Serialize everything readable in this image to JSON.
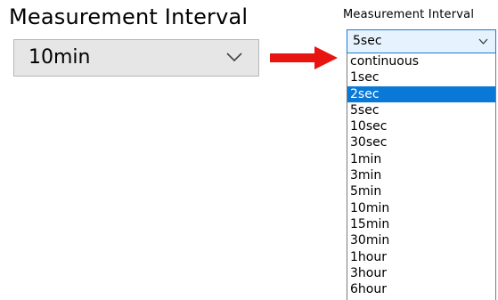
{
  "collapsed_dropdown": {
    "label": "Measurement Interval",
    "value": "10min",
    "icon": "chevron-down-icon"
  },
  "arrow": {
    "icon": "arrow-right-icon",
    "color": "#e8140f"
  },
  "expanded_dropdown": {
    "label": "Measurement Interval",
    "value": "5sec",
    "icon": "chevron-down-icon",
    "highlight_color": "#0a78d7",
    "selected_index": 2,
    "options": [
      "continuous",
      "1sec",
      "2sec",
      "5sec",
      "10sec",
      "30sec",
      "1min",
      "3min",
      "5min",
      "10min",
      "15min",
      "30min",
      "1hour",
      "3hour",
      "6hour"
    ]
  }
}
